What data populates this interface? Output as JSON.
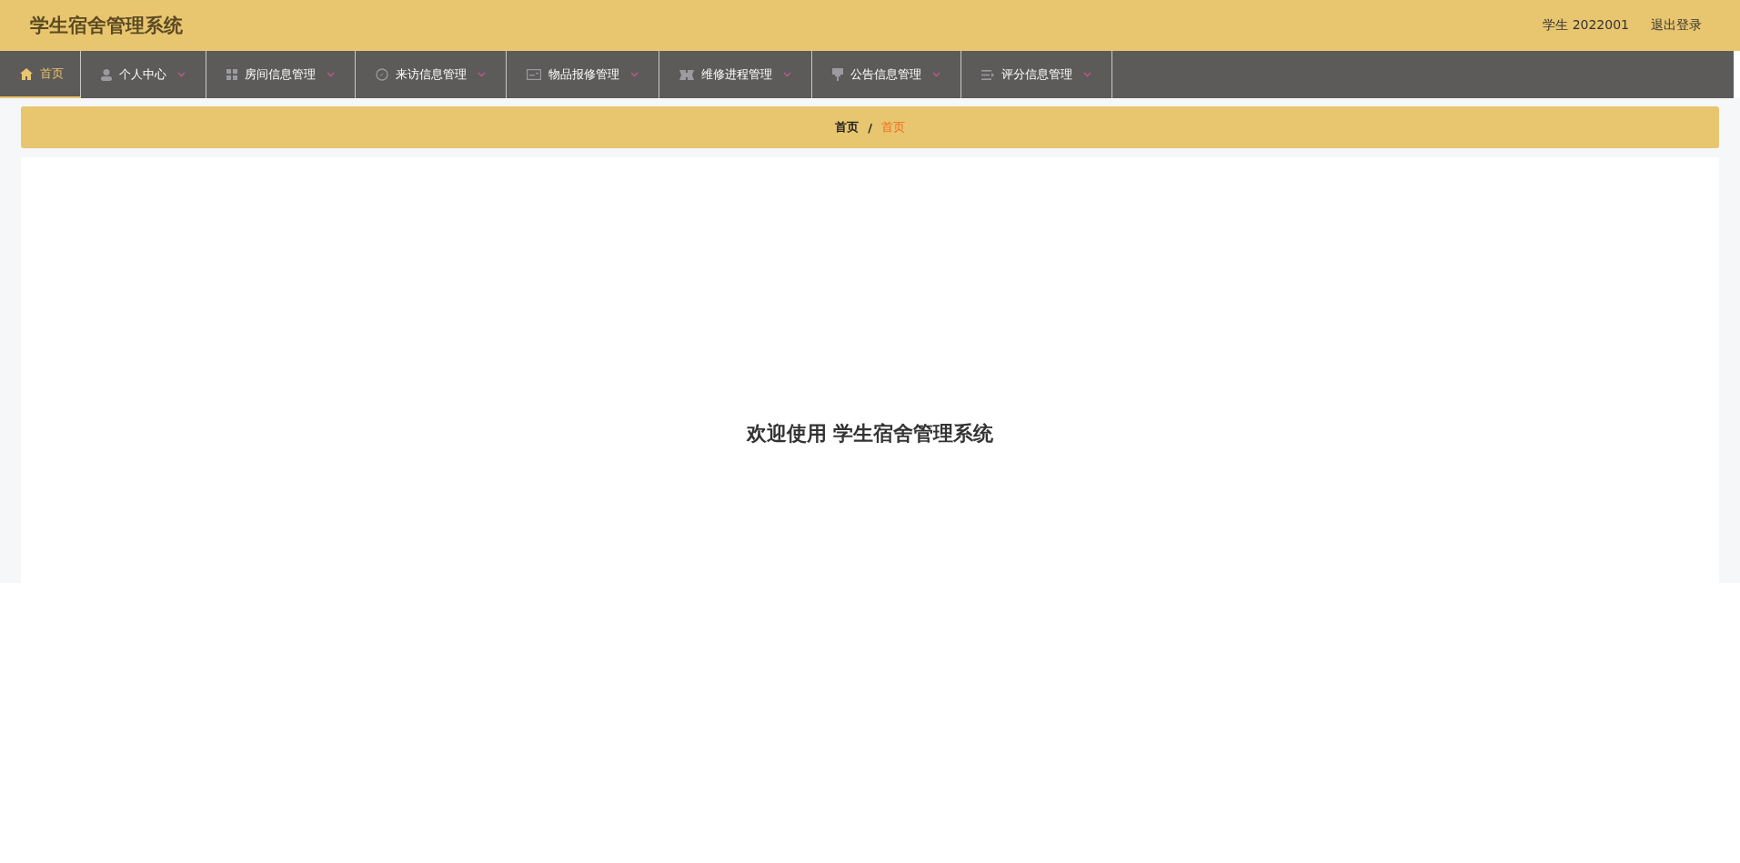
{
  "header": {
    "title": "学生宿舍管理系统",
    "user": "学生 2022001",
    "logout": "退出登录"
  },
  "nav": [
    {
      "label": "首页",
      "selected": true,
      "dropdown": false
    },
    {
      "label": "个人中心",
      "selected": false,
      "dropdown": true
    },
    {
      "label": "房间信息管理",
      "selected": false,
      "dropdown": true
    },
    {
      "label": "来访信息管理",
      "selected": false,
      "dropdown": true
    },
    {
      "label": "物品报修管理",
      "selected": false,
      "dropdown": true
    },
    {
      "label": "维修进程管理",
      "selected": false,
      "dropdown": true
    },
    {
      "label": "公告信息管理",
      "selected": false,
      "dropdown": true
    },
    {
      "label": "评分信息管理",
      "selected": false,
      "dropdown": true
    }
  ],
  "breadcrumb": {
    "items": [
      {
        "label": "首页",
        "selected": false
      },
      {
        "label": "首页",
        "selected": true
      }
    ],
    "separator": "/"
  },
  "welcome": "欢迎使用 学生宿舍管理系统"
}
